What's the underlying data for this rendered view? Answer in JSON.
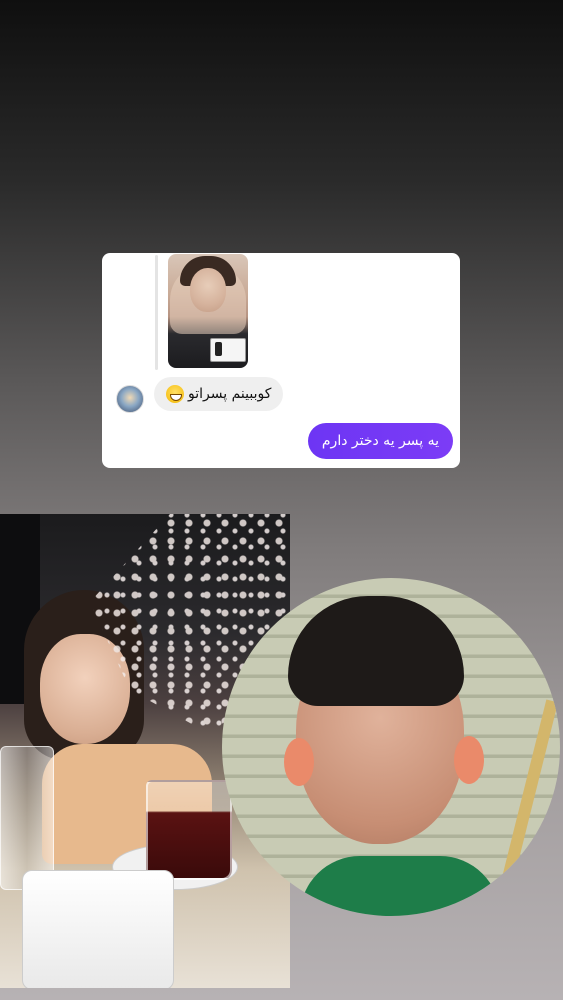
{
  "dm_card": {
    "reply_thumbnail": "reel-thumbnail",
    "incoming_message": "کوببینم پسراتو",
    "incoming_emoji": "grinning-face-emoji",
    "outgoing_message": "یه پسر یه دختر دارم"
  },
  "photos": {
    "left": "photo-girl-at-table",
    "right": "photo-boy-selfie-circle"
  }
}
